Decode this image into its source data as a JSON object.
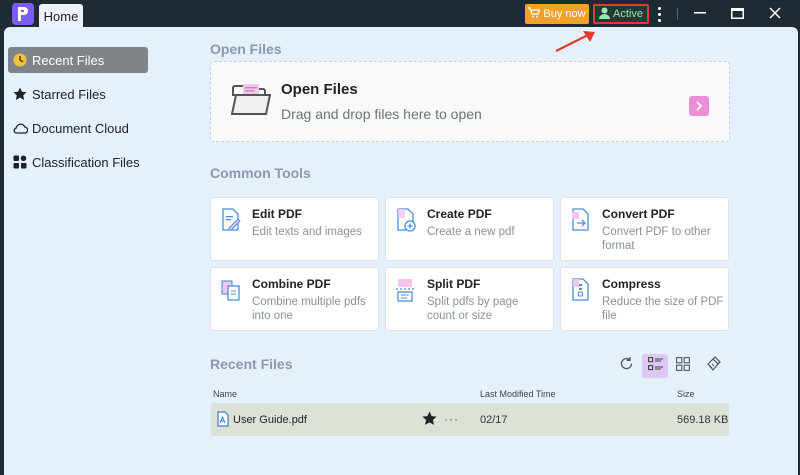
{
  "titlebar": {
    "tab_home": "Home",
    "buy_now": "Buy now",
    "active": "Active"
  },
  "sidebar": {
    "items": [
      {
        "label": "Recent Files",
        "icon": "clock-icon",
        "selected": true
      },
      {
        "label": "Starred Files",
        "icon": "star-icon",
        "selected": false
      },
      {
        "label": "Document Cloud",
        "icon": "cloud-icon",
        "selected": false
      },
      {
        "label": "Classification Files",
        "icon": "grid-icon",
        "selected": false
      }
    ]
  },
  "open_files": {
    "section_title": "Open Files",
    "title": "Open Files",
    "subtitle": "Drag and drop files here to open"
  },
  "common_tools": {
    "section_title": "Common Tools",
    "tools": [
      {
        "title": "Edit PDF",
        "desc": "Edit texts and images"
      },
      {
        "title": "Create PDF",
        "desc": "Create a new pdf"
      },
      {
        "title": "Convert PDF",
        "desc": "Convert PDF to other format"
      },
      {
        "title": "Combine PDF",
        "desc": "Combine multiple pdfs into one"
      },
      {
        "title": "Split PDF",
        "desc": "Split pdfs by page count or size"
      },
      {
        "title": "Compress",
        "desc": "Reduce the size of PDF file"
      }
    ]
  },
  "recent_files": {
    "section_title": "Recent Files",
    "columns": {
      "name": "Name",
      "modified": "Last Modified Time",
      "size": "Size"
    },
    "rows": [
      {
        "name": "User Guide.pdf",
        "modified": "02/17",
        "size": "569.18 KB",
        "more": "···"
      }
    ]
  },
  "colors": {
    "accent": "#7b5cf5",
    "buy_button": "#f4a12a",
    "highlight_border": "#e53b2c",
    "pink_accent": "#ed8fd6"
  }
}
